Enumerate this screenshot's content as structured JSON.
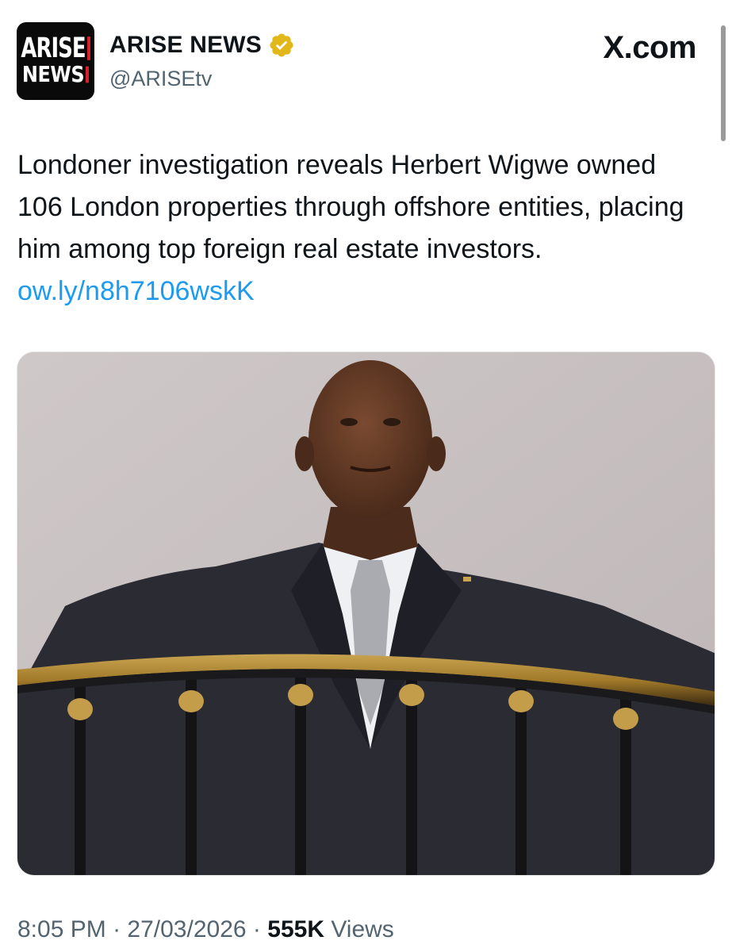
{
  "account": {
    "avatar_line1": "ARISE",
    "avatar_line2": "NEWS",
    "display_name": "ARISE NEWS",
    "handle": "@ARISEtv",
    "verified_icon": "gold-check-badge",
    "brand_red": "#d8202a"
  },
  "watermark": "X.com",
  "tweet": {
    "text": "Londoner investigation reveals Herbert Wigwe owned 106 London properties through offshore entities, placing him among top foreign real estate investors.",
    "link": "ow.ly/n8h7106wskK",
    "link_color": "#1d9bf0"
  },
  "meta": {
    "time": "8:05 PM",
    "separator": "·",
    "date": "27/03/2026",
    "views_count": "555K",
    "views_label": "Views"
  }
}
